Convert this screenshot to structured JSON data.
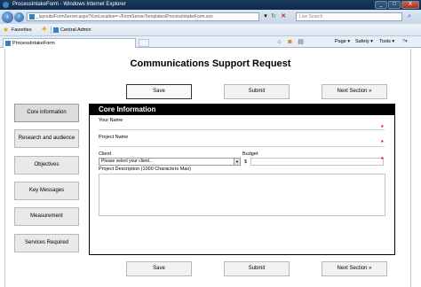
{
  "window": {
    "title": "ProcessIntakeForm - Windows Internet Explorer",
    "minimize": "_",
    "maximize": "□",
    "close": "X"
  },
  "address": {
    "back_icon": "arrow-left-icon",
    "url": "_layouts/FormServer.aspx?XsnLocation=~/FormServerTemplates/ProcessIntakeForm.xsn",
    "search_placeholder": "Live Search"
  },
  "favorites": {
    "label": "Favorites",
    "item": "Central Admin"
  },
  "tab": {
    "label": "ProcessIntakeForm"
  },
  "commands": {
    "page": "Page ▾",
    "safety": "Safety ▾",
    "tools": "Tools ▾",
    "help": "?▾"
  },
  "form": {
    "title": "Communications Support Request",
    "top_buttons": {
      "save": "Save",
      "submit": "Submit",
      "next": "Next Section »"
    },
    "bottom_buttons": {
      "save": "Save",
      "submit": "Submit",
      "next": "Next Section »"
    },
    "sidebar": [
      {
        "label": "Core information",
        "selected": true
      },
      {
        "label": "Research and audience",
        "selected": false
      },
      {
        "label": "Objectives",
        "selected": false
      },
      {
        "label": "Key Messages",
        "selected": false
      },
      {
        "label": "Measurement",
        "selected": false
      },
      {
        "label": "Services Required",
        "selected": false
      }
    ],
    "section": {
      "header": "Core Information",
      "your_name_label": "Your Name",
      "project_name_label": "Project Name",
      "client_label": "Client",
      "client_select": "Please select your client...",
      "budget_label": "Budget",
      "currency": "$",
      "description_label": "Project Description (1000 Characters Max)",
      "required_mark": "*"
    }
  }
}
